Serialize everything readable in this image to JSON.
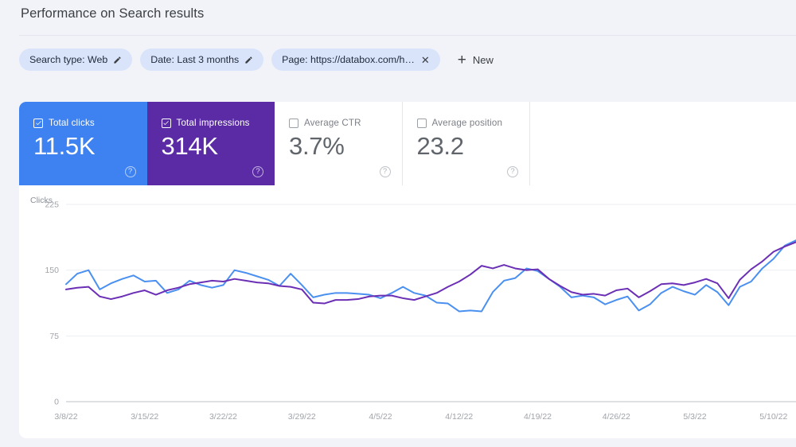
{
  "header": {
    "title": "Performance on Search results"
  },
  "filters": {
    "chips": [
      {
        "label": "Search type: Web",
        "icon": "pencil-icon",
        "closable": false
      },
      {
        "label": "Date: Last 3 months",
        "icon": "pencil-icon",
        "closable": false
      },
      {
        "label": "Page: https://databox.com/h…",
        "icon": "close-icon",
        "closable": true
      }
    ],
    "new_button": {
      "label": "New",
      "icon": "plus-icon"
    }
  },
  "metric_cards": [
    {
      "label": "Total clicks",
      "value": "11.5K",
      "checked": true,
      "color": "#3d82f0",
      "help": "?"
    },
    {
      "label": "Total impressions",
      "value": "314K",
      "checked": true,
      "color": "#5b2ba6",
      "help": "?"
    },
    {
      "label": "Average CTR",
      "value": "3.7%",
      "checked": false,
      "color": "#ffffff",
      "help": "?"
    },
    {
      "label": "Average position",
      "value": "23.2",
      "checked": false,
      "color": "#ffffff",
      "help": "?"
    }
  ],
  "chart_data": {
    "type": "line",
    "title": "",
    "ylabel": "Clicks",
    "xlabel": "",
    "ylim": [
      0,
      225
    ],
    "yticks": [
      0,
      75,
      150,
      225
    ],
    "ytick_labels": [
      "0",
      "75",
      "150",
      "225"
    ],
    "grid": true,
    "legend": "none",
    "xtick_labels": [
      "3/8/22",
      "3/15/22",
      "3/22/22",
      "3/29/22",
      "4/5/22",
      "4/12/22",
      "4/19/22",
      "4/26/22",
      "5/3/22",
      "5/10/22"
    ],
    "xtick_indices": [
      0,
      7,
      14,
      21,
      28,
      35,
      42,
      49,
      56,
      63
    ],
    "x": [
      "3/8/22",
      "3/9/22",
      "3/10/22",
      "3/11/22",
      "3/12/22",
      "3/13/22",
      "3/14/22",
      "3/15/22",
      "3/16/22",
      "3/17/22",
      "3/18/22",
      "3/19/22",
      "3/20/22",
      "3/21/22",
      "3/22/22",
      "3/23/22",
      "3/24/22",
      "3/25/22",
      "3/26/22",
      "3/27/22",
      "3/28/22",
      "3/29/22",
      "3/30/22",
      "3/31/22",
      "4/1/22",
      "4/2/22",
      "4/3/22",
      "4/4/22",
      "4/5/22",
      "4/6/22",
      "4/7/22",
      "4/8/22",
      "4/9/22",
      "4/10/22",
      "4/11/22",
      "4/12/22",
      "4/13/22",
      "4/14/22",
      "4/15/22",
      "4/16/22",
      "4/17/22",
      "4/18/22",
      "4/19/22",
      "4/20/22",
      "4/21/22",
      "4/22/22",
      "4/23/22",
      "4/24/22",
      "4/25/22",
      "4/26/22",
      "4/27/22",
      "4/28/22",
      "4/29/22",
      "4/30/22",
      "5/1/22",
      "5/2/22",
      "5/3/22",
      "5/4/22",
      "5/5/22",
      "5/6/22",
      "5/7/22",
      "5/8/22",
      "5/9/22",
      "5/10/22",
      "5/11/22",
      "5/12/22"
    ],
    "series": [
      {
        "name": "Total clicks",
        "color": "#4a90f0",
        "values": [
          134,
          146,
          150,
          128,
          135,
          140,
          144,
          137,
          138,
          124,
          128,
          138,
          133,
          130,
          133,
          150,
          147,
          143,
          139,
          132,
          146,
          133,
          119,
          122,
          124,
          124,
          123,
          122,
          118,
          124,
          131,
          124,
          121,
          113,
          112,
          103,
          104,
          103,
          125,
          138,
          141,
          152,
          149,
          140,
          131,
          119,
          121,
          119,
          111,
          116,
          120,
          104,
          111,
          124,
          131,
          126,
          122,
          133,
          125,
          110,
          131,
          137,
          152,
          163,
          178,
          184
        ]
      },
      {
        "name": "Total impressions",
        "color": "#6b2fb5",
        "values": [
          128,
          130,
          131,
          120,
          117,
          120,
          124,
          127,
          122,
          127,
          130,
          134,
          136,
          138,
          137,
          140,
          138,
          136,
          135,
          132,
          131,
          128,
          113,
          112,
          116,
          116,
          117,
          120,
          121,
          121,
          118,
          116,
          120,
          124,
          131,
          137,
          145,
          155,
          152,
          156,
          152,
          150,
          151,
          140,
          132,
          125,
          122,
          123,
          121,
          127,
          129,
          119,
          126,
          134,
          135,
          133,
          136,
          140,
          135,
          118,
          139,
          151,
          160,
          171,
          177,
          182
        ]
      }
    ]
  }
}
